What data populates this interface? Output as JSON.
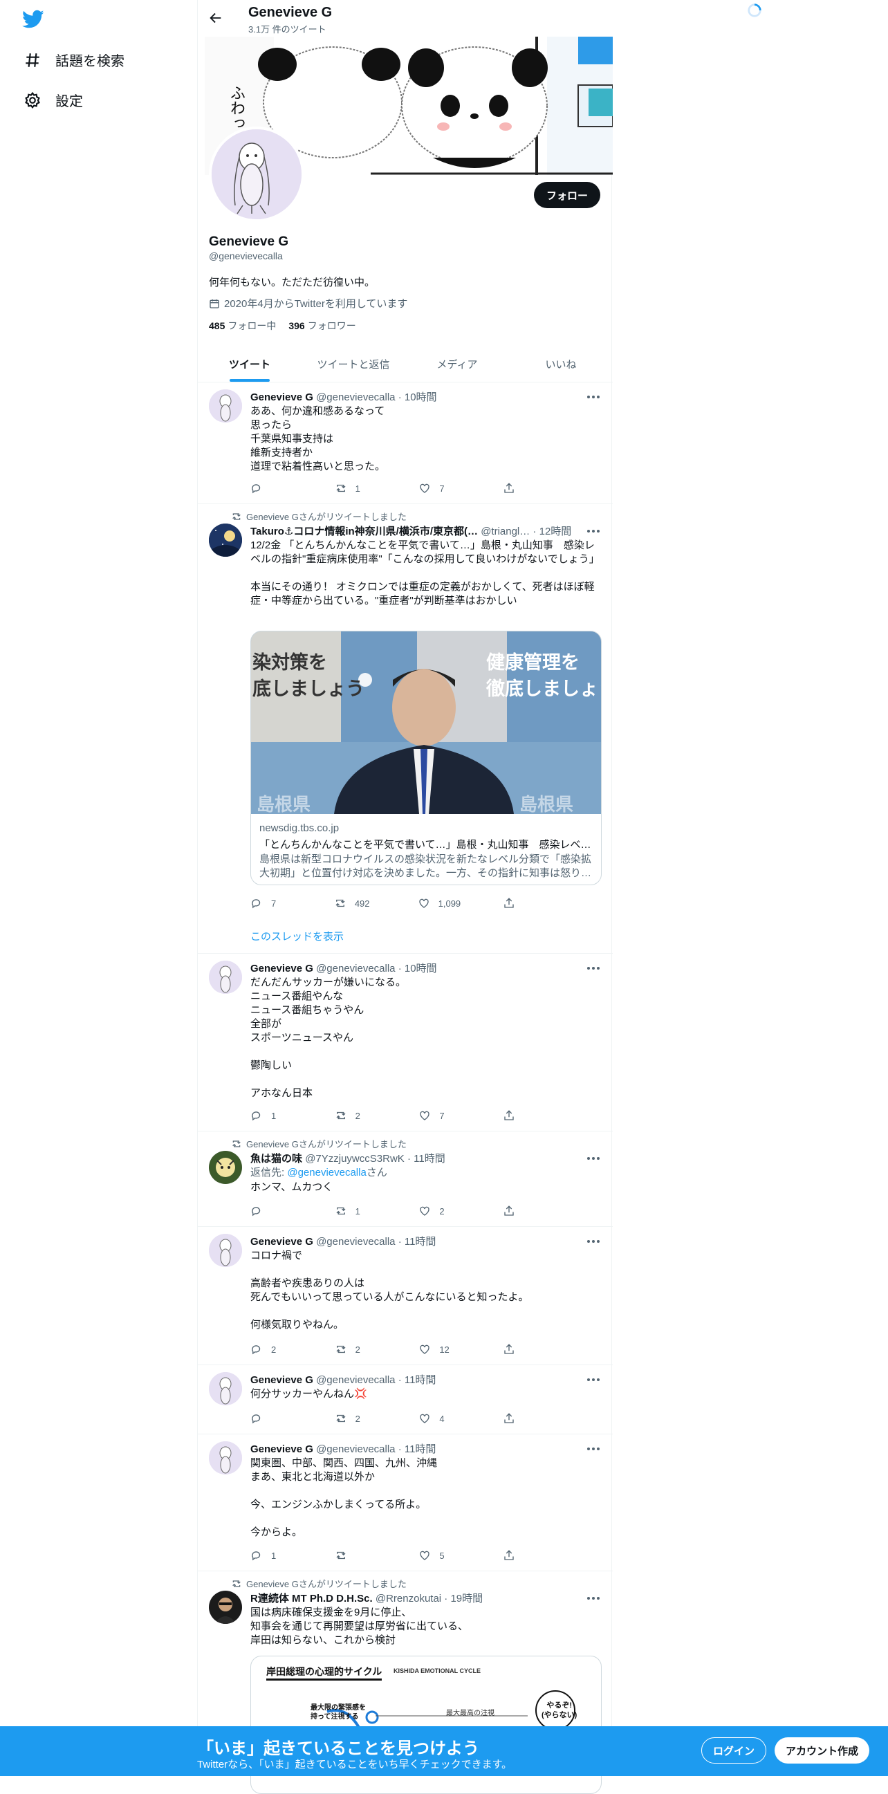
{
  "nav": {
    "explore_label": "話題を検索",
    "settings_label": "設定"
  },
  "header": {
    "title": "Genevieve G",
    "tweet_count": "3.1万 件のツイート"
  },
  "banner": {
    "text": "ふわっ"
  },
  "profile": {
    "follow_label": "フォロー",
    "name": "Genevieve G",
    "handle": "@genevievecalla",
    "bio": "何年何もない。ただただ彷徨い中。",
    "joined": "2020年4月からTwitterを利用しています",
    "following_count": "485",
    "following_label": "フォロー中",
    "followers_count": "396",
    "followers_label": "フォロワー"
  },
  "tabs": [
    "ツイート",
    "ツイートと返信",
    "メディア",
    "いいね"
  ],
  "tweets": [
    {
      "name": "Genevieve G",
      "meta": "@genevievecalla · 10時間",
      "body": "ああ、何か違和感あるなって\n思ったら\n千葉県知事支持は\n維新支持者か\n道理で粘着性高いと思った。",
      "replies": "",
      "retweets": "1",
      "likes": "7"
    },
    {
      "rt_label": "Genevieve Gさんがリツイートしました",
      "name": "Takuro⚓コロナ情報in神奈川県/横浜市/東京都(…",
      "meta": "@triangl… · 12時間",
      "body": "12/2金 「とんちんかんなことを平気で書いて…」島根・丸山知事　感染レベルの指針\"重症病床使用率\"「こんなの採用して良いわけがないでしょう」\n\n本当にその通り！ オミクロンでは重症の定義がおかしくて、死者はほぼ軽症・中等症から出ている。\"重症者\"が判断基準はおかしい",
      "card_image_left": "染対策を\n底しましょう",
      "card_image_right": "健康管理を\n徹底しましょう",
      "card_image_bottom_left": "島根県",
      "card_image_bottom_right": "島根県",
      "card_domain": "newsdig.tbs.co.jp",
      "card_title": "「とんちんかんなことを平気で書いて…」島根・丸山知事　感染レベ…",
      "card_desc": "島根県は新型コロナウイルスの感染状況を新たなレベル分類で「感染拡大初期」と位置付け対応を決めました。一方、その指針に知事は怒り…",
      "replies": "7",
      "retweets": "492",
      "likes": "1,099",
      "thread_link": "このスレッドを表示"
    },
    {
      "name": "Genevieve G",
      "meta": "@genevievecalla · 10時間",
      "body": "だんだんサッカーが嫌いになる。\nニュース番組やんな\nニュース番組ちゃうやん\n全部が\nスポーツニュースやん\n\n鬱陶しい\n\nアホなん日本",
      "replies": "1",
      "retweets": "2",
      "likes": "7"
    },
    {
      "rt_label": "Genevieve Gさんがリツイートしました",
      "name": "魚は猫の味",
      "meta": "@7YzzjuywccS3RwK · 11時間",
      "reply_prefix": "返信先: ",
      "reply_handle": "@genevievecalla",
      "reply_suffix": "さん",
      "body": "ホンマ、ムカつく",
      "replies": "",
      "retweets": "1",
      "likes": "2"
    },
    {
      "name": "Genevieve G",
      "meta": "@genevievecalla · 11時間",
      "body": "コロナ禍で\n\n高齢者や疾患ありの人は\n死んでもいいって思っている人がこんなにいると知ったよ。\n\n何様気取りやねん。",
      "replies": "2",
      "retweets": "2",
      "likes": "12"
    },
    {
      "name": "Genevieve G",
      "meta": "@genevievecalla · 11時間",
      "body": "何分サッカーやんねん💢",
      "replies": "",
      "retweets": "2",
      "likes": "4"
    },
    {
      "name": "Genevieve G",
      "meta": "@genevievecalla · 11時間",
      "body": "関東圏、中部、関西、四国、九州、沖縄\nまあ、東北と北海道以外か\n\n今、エンジンふかしまくってる所よ。\n\n今からよ。",
      "replies": "1",
      "retweets": "",
      "likes": "5"
    },
    {
      "rt_label": "Genevieve Gさんがリツイートしました",
      "name": "R連続体 MT Ph.D D.H.Sc.",
      "meta": "@Rrenzokutai · 19時間",
      "body": "国は病床確保支援金を9月に停止、\n知事会を通じて再開要望は厚労省に出ている、\n岸田は知らない、これから検討",
      "image_title": "岸田総理の心理的サイクル",
      "image_subtitle": "KISHIDA EMOTIONAL CYCLE",
      "image_label_1": "最大限の緊張感を\n持って注視する",
      "image_label_2": "最大最高の注視",
      "image_label_3": "やるぞ!\n(やらない)"
    }
  ],
  "bottom_bar": {
    "title": "「いま」起きていることを見つけよう",
    "subtitle": "Twitterなら、「いま」起きていることをいち早くチェックできます。",
    "login_label": "ログイン",
    "signup_label": "アカウント作成"
  },
  "colors": {
    "accent": "#1d9bf0",
    "text": "#0f1419",
    "muted": "#536471"
  }
}
